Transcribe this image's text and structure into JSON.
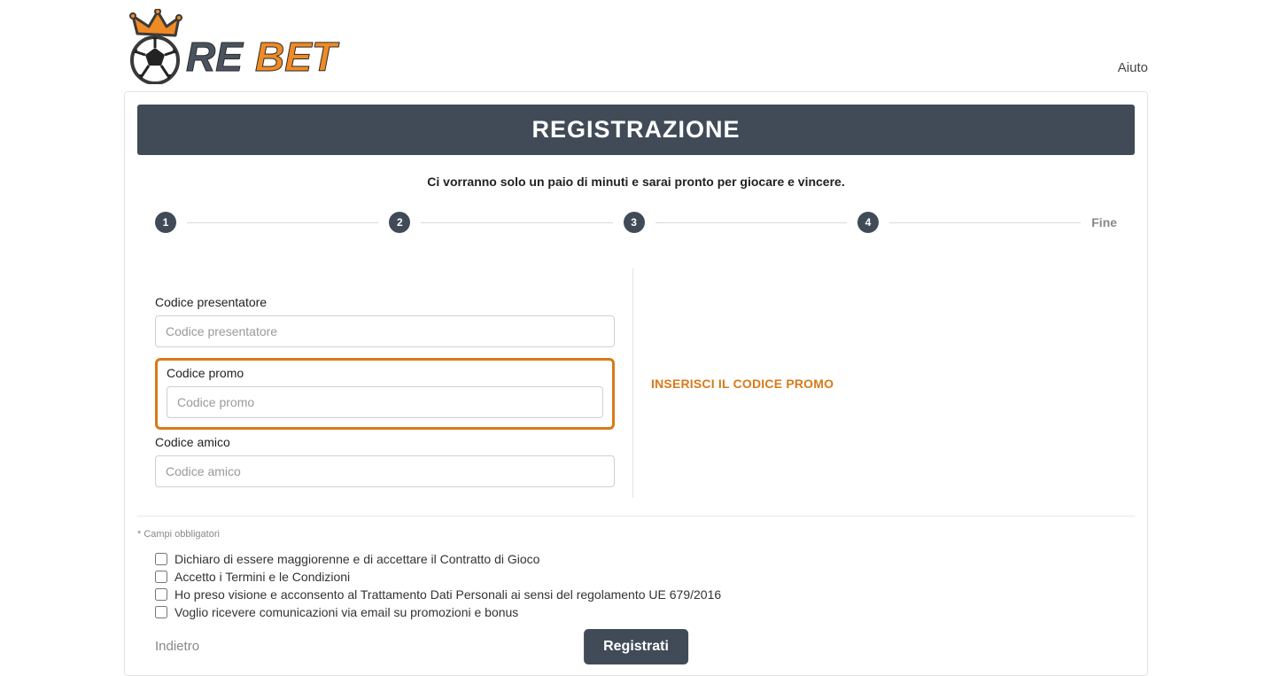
{
  "header": {
    "help_label": "Aiuto"
  },
  "title": "REGISTRAZIONE",
  "subtitle": "Ci vorranno solo un paio di minuti e sarai pronto per giocare e vincere.",
  "steps": {
    "s1": "1",
    "s2": "2",
    "s3": "3",
    "s4": "4",
    "fine": "Fine"
  },
  "form": {
    "presenter_label": "Codice presentatore",
    "presenter_placeholder": "Codice presentatore",
    "promo_label": "Codice promo",
    "promo_placeholder": "Codice promo",
    "friend_label": "Codice amico",
    "friend_placeholder": "Codice amico",
    "promo_hint": "INSERISCI IL CODICE PROMO"
  },
  "mandatory_note": "* Campi obbligatori",
  "checks": {
    "c1": "Dichiaro di essere maggiorenne e di accettare il Contratto di Gioco",
    "c2": "Accetto i Termini e le Condizioni",
    "c3": "Ho preso visione e acconsento al Trattamento Dati Personali ai sensi del regolamento UE 679/2016",
    "c4": "Voglio ricevere comunicazioni via email su promozioni e bonus"
  },
  "actions": {
    "back": "Indietro",
    "submit": "Registrati"
  }
}
